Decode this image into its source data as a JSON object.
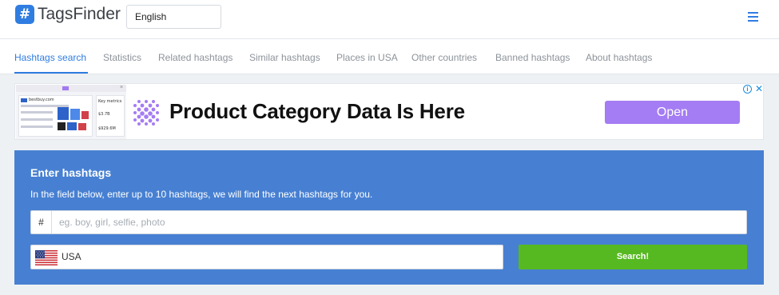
{
  "app": {
    "logo_symbol": "#",
    "logo_text": "TagsFinder",
    "brand_color": "#2f7de1"
  },
  "header": {
    "language": "English",
    "menu_icon": "hamburger-menu-icon"
  },
  "tabs": [
    {
      "label": "Hashtags search",
      "active": true
    },
    {
      "label": "Statistics",
      "active": false
    },
    {
      "label": "Related hashtags",
      "active": false
    },
    {
      "label": "Similar hashtags",
      "active": false
    },
    {
      "label": "Places in USA",
      "active": false
    },
    {
      "label": "Other countries",
      "active": false
    },
    {
      "label": "Banned hashtags",
      "active": false
    },
    {
      "label": "About hashtags",
      "active": false
    }
  ],
  "ad": {
    "title": "Product Category Data Is Here",
    "open_label": "Open",
    "info_symbol": "i",
    "close_symbol": "✕",
    "preview_brand": "bestbuy.com",
    "preview_heading": "Key metrics",
    "preview_value_1": "$3.7B",
    "preview_value_2": "$929.6M",
    "accent_color": "#a47cf3"
  },
  "search_panel": {
    "title": "Enter hashtags",
    "description": "In the field below, enter up to 10 hashtags, we will find the next hashtags for you.",
    "hash_prefix": "#",
    "input_value": "",
    "input_placeholder": "eg. boy, girl, selfie, photo",
    "country": "USA",
    "country_flag_icon": "us-flag-icon",
    "search_label": "Search!",
    "panel_color": "#4780d2",
    "search_color": "#57b921"
  }
}
